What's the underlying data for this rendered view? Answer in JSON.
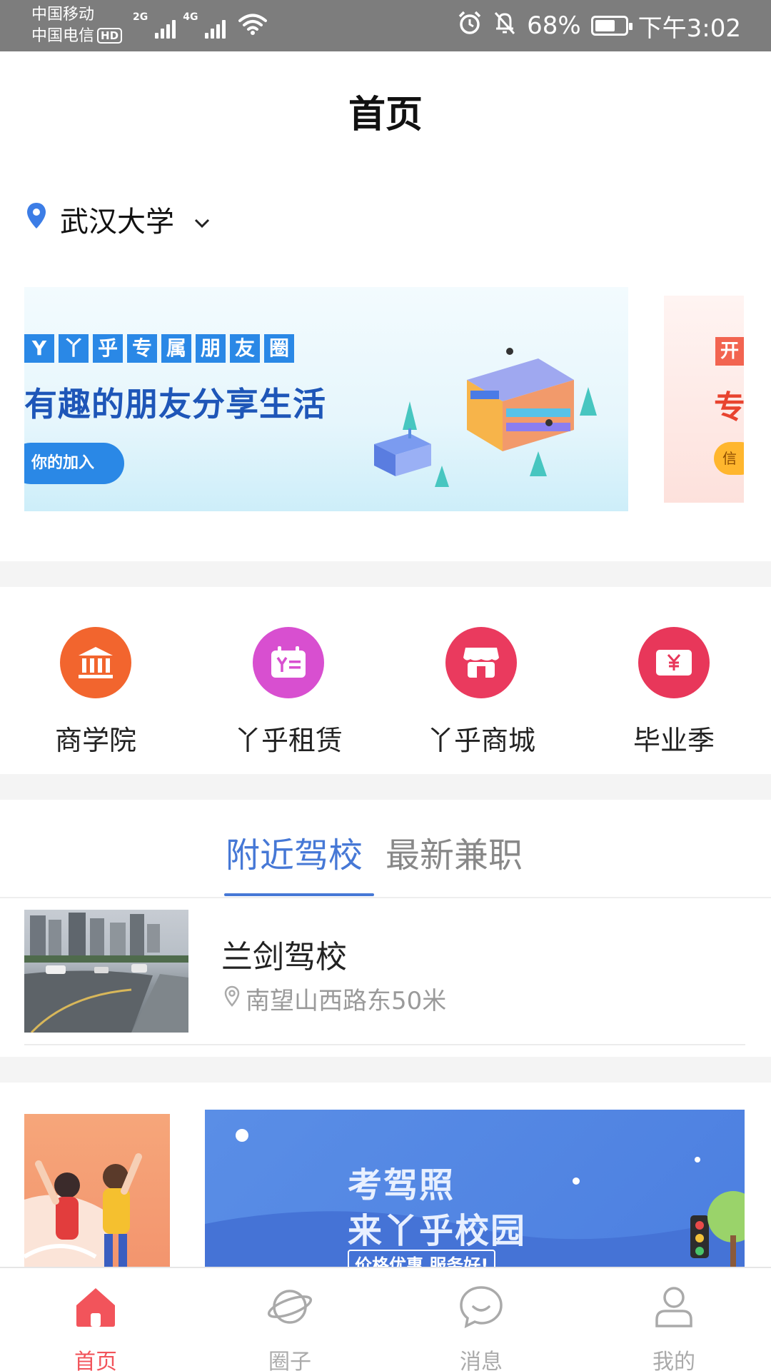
{
  "status_bar": {
    "carrier1": "中国移动",
    "carrier2": "中国电信",
    "hd": "HD",
    "net1": "2G",
    "net2": "4G",
    "battery": "68%",
    "battery_level": 0.68,
    "time": "下午3:02"
  },
  "header": {
    "title": "首页"
  },
  "location": {
    "name": "武汉大学"
  },
  "banner": {
    "tags": [
      "Y",
      "丫",
      "乎",
      "专",
      "属",
      "朋",
      "友",
      "圈"
    ],
    "headline": "有趣的朋友分享生活",
    "button": "你的加入",
    "next_tag": "开",
    "next_big": "专",
    "next_pill": "信"
  },
  "quick_entries": [
    {
      "label": "商学院",
      "icon": "bank-icon",
      "color": "#f2652e"
    },
    {
      "label": "丫乎租赁",
      "icon": "calendar-icon",
      "color": "#d84fd0"
    },
    {
      "label": "丫乎商城",
      "icon": "store-icon",
      "color": "#ea3a5e"
    },
    {
      "label": "毕业季",
      "icon": "wallet-yen-icon",
      "color": "#e8375a"
    }
  ],
  "tabs": [
    {
      "label": "附近驾校",
      "active": true
    },
    {
      "label": "最新兼职",
      "active": false
    }
  ],
  "driving_schools": [
    {
      "name": "兰剑驾校",
      "address": "南望山西路东50米"
    }
  ],
  "promo": {
    "line1": "考驾照",
    "line2": "来丫乎校园",
    "line3": "价格优惠 服务好!"
  },
  "bottom_nav": [
    {
      "label": "首页",
      "icon": "home-icon",
      "active": true
    },
    {
      "label": "圈子",
      "icon": "planet-icon",
      "active": false
    },
    {
      "label": "消息",
      "icon": "chat-bubble-icon",
      "active": false
    },
    {
      "label": "我的",
      "icon": "user-icon",
      "active": false
    }
  ],
  "colors": {
    "accent": "#4678d6",
    "nav_active": "#f2545b",
    "status_bar": "#7d7d7d"
  }
}
